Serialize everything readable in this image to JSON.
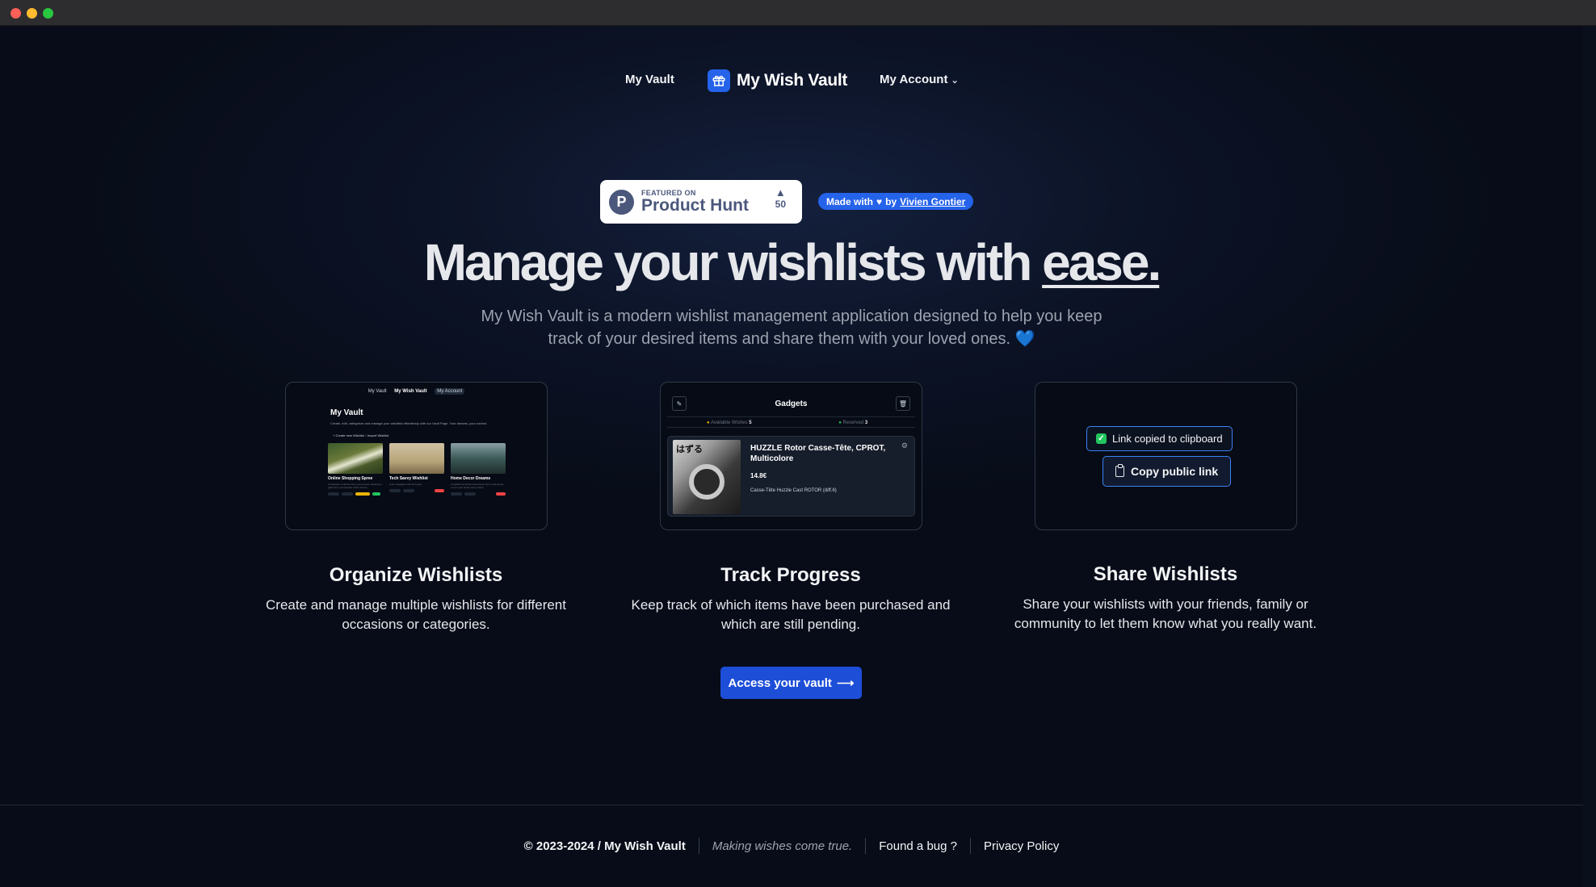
{
  "nav": {
    "vault_label": "My Vault",
    "brand_name": "My Wish Vault",
    "account_label": "My Account"
  },
  "badges": {
    "ph_featured": "FEATURED ON",
    "ph_name": "Product Hunt",
    "ph_logo_letter": "P",
    "ph_votes": "50",
    "made_with": "Made with",
    "by": "by",
    "author": "Vivien Gontier"
  },
  "hero": {
    "title_main": "Manage your wishlists with ",
    "title_emph": "ease.",
    "subtitle": "My Wish Vault is a modern wishlist management application designed to help you keep track of your desired items and share them with your loved ones.",
    "heart": "💙"
  },
  "card_vault": {
    "nav": [
      "My Vault",
      "My Wish Vault",
      "My Account"
    ],
    "title": "My Vault",
    "desc": "Create, edit, categorize and manage your wishlists effortlessly with our Vault Page. Your dreams, your control.",
    "actions": "+ Create new Wishlist     ↓ Import Wishlist",
    "lists": [
      {
        "name": "Online Shopping Spree",
        "text": "A collection of all the items you've been wanting to grab from your favorite online stores."
      },
      {
        "name": "Tech Savvy Wishlist",
        "text": "A list of gadgets and tech gear."
      },
      {
        "name": "Home Decor Dreams",
        "text": "A wishlist for all the home decor items and pieces to turn your house into a home."
      }
    ]
  },
  "card_gadgets": {
    "title": "Gadgets",
    "available_label": "Available Wishes",
    "available_count": "5",
    "reserved_label": "Reserved",
    "reserved_count": "3",
    "item_name": "HUZZLE Rotor Casse-Tête, CPROT, Multicolore",
    "item_price": "14.8€",
    "item_desc": "Casse-Tête Huzzle Cast ROTOR (diff.6)",
    "item_jp": "はずる"
  },
  "card_share": {
    "toast": "Link copied to clipboard",
    "copy_button": "Copy public link"
  },
  "features": [
    {
      "title": "Organize Wishlists",
      "desc": "Create and manage multiple wishlists for different occasions or categories."
    },
    {
      "title": "Track Progress",
      "desc": "Keep track of which items have been purchased and which are still pending."
    },
    {
      "title": "Share Wishlists",
      "desc": "Share your wishlists with your friends, family or community to let them know what you really want."
    }
  ],
  "cta": {
    "label": "Access your vault",
    "arrow": "⟶"
  },
  "footer": {
    "copyright": "© 2023-2024 / My Wish Vault",
    "tagline": "Making wishes come true.",
    "bug_link": "Found a bug ?",
    "privacy_link": "Privacy Policy"
  },
  "colors": {
    "accent": "#2563eb",
    "background": "#0a0f1c",
    "success": "#22c55e"
  }
}
